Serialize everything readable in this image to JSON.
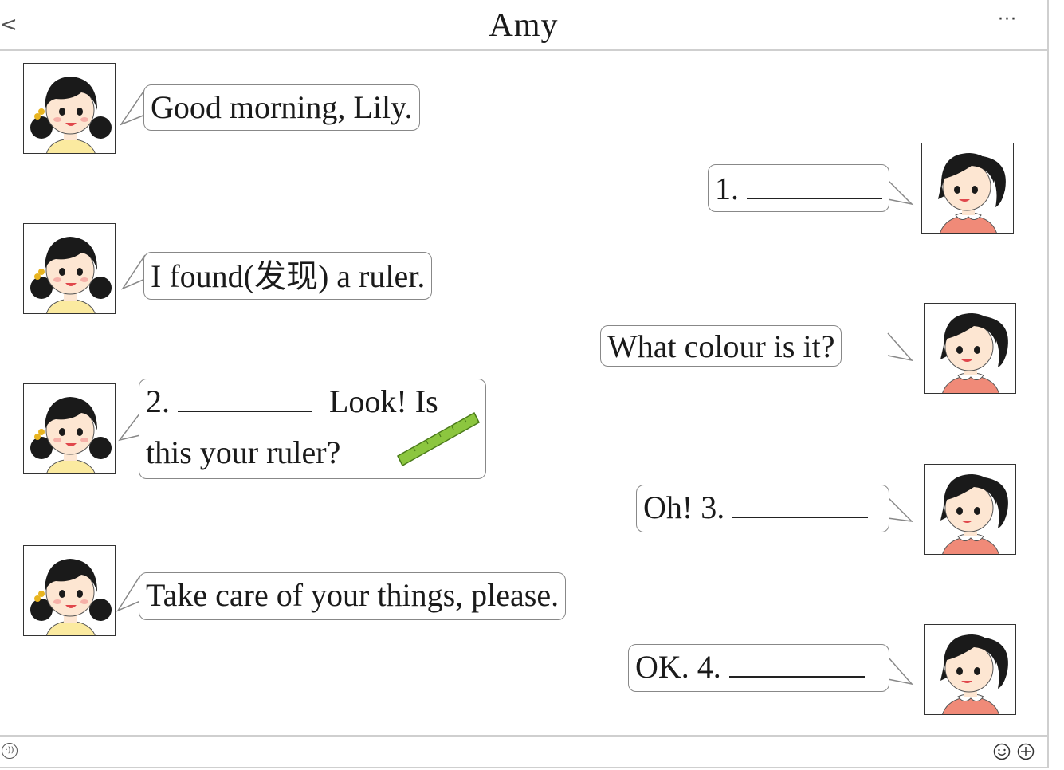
{
  "header": {
    "back_icon": "chevron-left-icon",
    "back_glyph": "<",
    "title": "Amy",
    "more_icon": "more-dots-icon",
    "more_glyph": "···"
  },
  "messages": [
    {
      "sender": "Amy",
      "text": "Good morning, Lily."
    },
    {
      "sender": "Lily",
      "number": "1."
    },
    {
      "sender": "Amy",
      "text": "I found(发现) a ruler."
    },
    {
      "sender": "Lily",
      "text": "What colour is it?"
    },
    {
      "sender": "Amy",
      "number": "2.",
      "text_after_blank": "Look! Is",
      "line2": "this your ruler?"
    },
    {
      "sender": "Lily",
      "text": "Oh!",
      "number": "3."
    },
    {
      "sender": "Amy",
      "text": "Take care of your things, please."
    },
    {
      "sender": "Lily",
      "text": "OK.",
      "number": "4."
    }
  ],
  "footer": {
    "voice_icon": "voice-icon",
    "voice_glyph": "·))",
    "emoji_icon": "emoji-icon",
    "plus_icon": "plus-icon"
  },
  "colors": {
    "ruler": "#8cc63f",
    "amy_shirt": "#fbeaa0",
    "lily_shirt": "#f08a78",
    "hair": "#1a1a1a",
    "border": "#cfcfcf"
  }
}
